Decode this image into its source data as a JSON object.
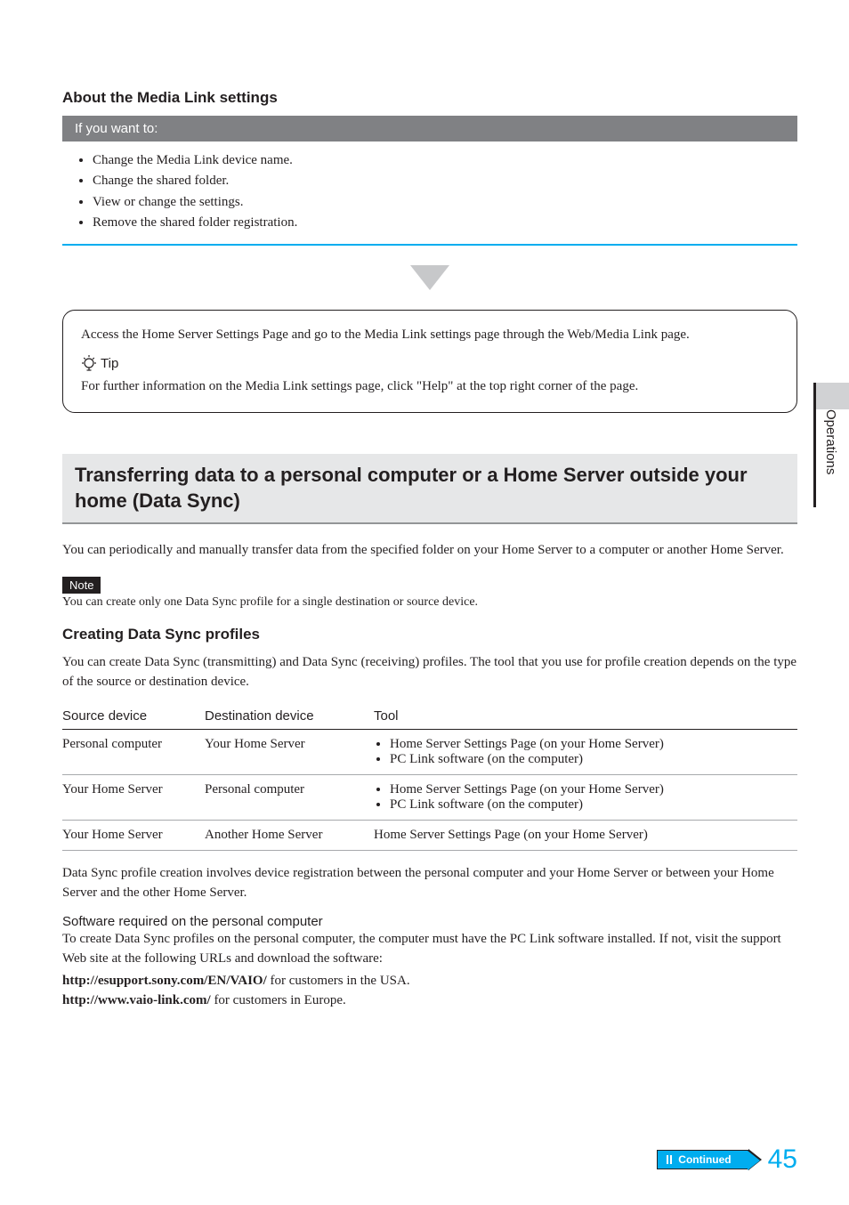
{
  "side_label": "Operations",
  "about": {
    "heading": "About the Media Link settings",
    "bar": "If you want to:",
    "items": [
      "Change the Media Link device name.",
      "Change the shared folder.",
      "View or change the settings.",
      "Remove the shared folder registration."
    ]
  },
  "rounded": {
    "p1": "Access the Home Server Settings Page and go to the Media Link settings page through the Web/Media Link page.",
    "tip_label": "Tip",
    "p2": "For further information on the Media Link settings page, click \"Help\" at the top right corner of the page."
  },
  "transfer": {
    "title": "Transferring data to a personal computer or a Home Server outside your home (Data Sync)",
    "intro": "You can periodically and  manually transfer data from the specified folder on your Home Server to a computer or another Home Server.",
    "note_label": "Note",
    "note_text": "You can create only one Data Sync profile for a single destination or source device."
  },
  "profiles": {
    "heading": "Creating Data Sync profiles",
    "intro": "You can create Data Sync (transmitting) and Data Sync (receiving) profiles. The tool that you use for profile creation depends on the type of the source or destination device.",
    "headers": {
      "c1": "Source device",
      "c2": "Destination device",
      "c3": "Tool"
    },
    "rows": [
      {
        "src": "Personal computer",
        "dst": "Your Home Server",
        "tools": [
          "Home Server Settings Page (on your Home Server)",
          "PC Link software (on the computer)"
        ]
      },
      {
        "src": "Your Home Server",
        "dst": "Personal computer",
        "tools": [
          "Home Server Settings Page (on your Home Server)",
          "PC Link software (on the computer)"
        ]
      },
      {
        "src": "Your Home Server",
        "dst": "Another Home Server",
        "tools_single": "Home Server Settings Page (on your Home Server)"
      }
    ],
    "after": "Data Sync profile creation involves device registration between the personal computer and your Home Server or between your Home Server and the other Home Server."
  },
  "software": {
    "subhead": "Software required on the personal computer",
    "p": "To create Data Sync profiles on the personal computer, the computer must have the PC Link software installed. If not, visit the support Web site at the following URLs and download the software:",
    "url1_bold": "http://esupport.sony.com/EN/VAIO/",
    "url1_rest": " for customers in the USA.",
    "url2_bold": "http://www.vaio-link.com/",
    "url2_rest": " for customers in Europe."
  },
  "footer": {
    "continued": "Continued",
    "page": "45"
  }
}
